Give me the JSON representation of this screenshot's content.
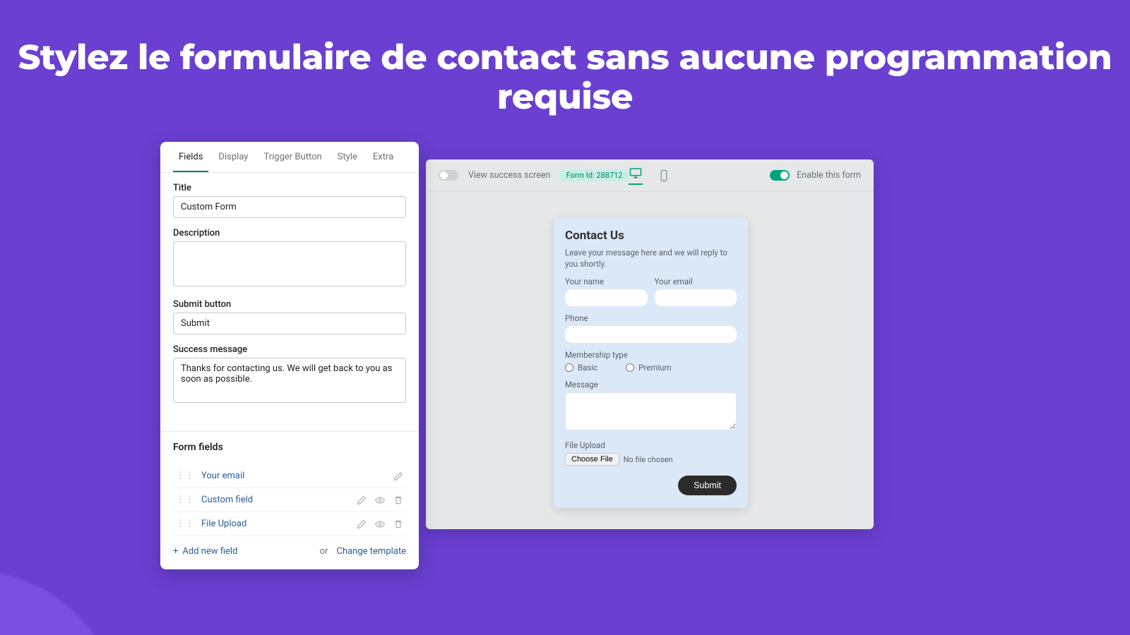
{
  "hero": {
    "title": "Stylez le formulaire de contact sans aucune programmation requise"
  },
  "editor": {
    "tabs": [
      "Fields",
      "Display",
      "Trigger Button",
      "Style",
      "Extra"
    ],
    "active_tab": 0,
    "title_label": "Title",
    "title_value": "Custom Form",
    "description_label": "Description",
    "description_value": "",
    "submit_label": "Submit button",
    "submit_value": "Submit",
    "success_label": "Success message",
    "success_value": "Thanks for contacting us. We will get back to you as soon as possible.",
    "form_fields_heading": "Form fields",
    "fields": [
      {
        "name": "Your email",
        "show_visibility": false,
        "show_delete": false
      },
      {
        "name": "Custom field",
        "show_visibility": true,
        "show_delete": true
      },
      {
        "name": "File Upload",
        "show_visibility": true,
        "show_delete": true
      }
    ],
    "add_field_label": "Add new field",
    "or_label": "or",
    "change_template_label": "Change template"
  },
  "preview_toolbar": {
    "view_success_label": "View success screen",
    "form_id_label": "Form Id: 288712",
    "enable_label": "Enable this form",
    "enable_on": true,
    "view_success_on": false,
    "device": "desktop"
  },
  "form_card": {
    "title": "Contact Us",
    "desc": "Leave your message here and we will reply to you shortly.",
    "name_label": "Your name",
    "email_label": "Your email",
    "phone_label": "Phone",
    "membership_label": "Membership type",
    "radios": [
      "Basic",
      "Premium"
    ],
    "message_label": "Message",
    "file_label": "File Upload",
    "choose_file_label": "Choose File",
    "no_file_label": "No file chosen",
    "submit_label": "Submit"
  }
}
